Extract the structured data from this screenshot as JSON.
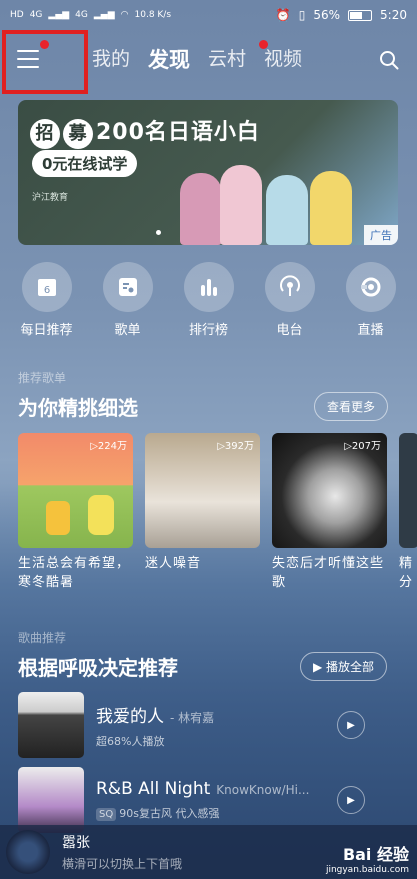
{
  "status": {
    "signal_left": "HD",
    "net1": "4G",
    "net2": "4G",
    "speed": "10.8 K/s",
    "battery": "56%",
    "time": "5:20"
  },
  "nav": {
    "tabs": [
      "我的",
      "发现",
      "云村",
      "视频"
    ],
    "active_index": 1
  },
  "banner": {
    "badge1": "招",
    "badge2": "募",
    "headline": "200名日语小白",
    "sub": "0元在线试学",
    "brand": "沪江教育",
    "ad_label": "广告"
  },
  "quick": [
    {
      "label": "每日推荐",
      "icon": "calendar-icon",
      "day": "6"
    },
    {
      "label": "歌单",
      "icon": "playlist-icon"
    },
    {
      "label": "排行榜",
      "icon": "chart-icon"
    },
    {
      "label": "电台",
      "icon": "radio-icon"
    },
    {
      "label": "直播",
      "icon": "live-icon"
    }
  ],
  "playlists": {
    "small_title": "推荐歌单",
    "title": "为你精挑细选",
    "more": "查看更多",
    "items": [
      {
        "count": "▷224万",
        "title": "生活总会有希望，寒冬酷暑"
      },
      {
        "count": "▷392万",
        "title": "迷人噪音"
      },
      {
        "count": "▷207万",
        "title": "失恋后才听懂这些歌"
      },
      {
        "count": "",
        "title": "精分"
      }
    ]
  },
  "songs": {
    "small_title": "歌曲推荐",
    "title": "根据呼吸决定推荐",
    "play_all": "▶ 播放全部",
    "items": [
      {
        "name": "我爱的人",
        "artist": "- 林宥嘉",
        "tag": "",
        "desc": "超68%人播放"
      },
      {
        "name": "R&B All Night",
        "artist": "KnowKnow/Hi...",
        "tag": "SQ",
        "desc": "90s复古风 代入感强"
      }
    ]
  },
  "player": {
    "name": "嚣张",
    "hint": "横滑可以切换上下首哦"
  },
  "watermark": {
    "line1": "Bai 经验",
    "line2": "jingyan.baidu.com"
  },
  "colors": {
    "accent_red": "#e8232c",
    "highlight_box": "#e02020"
  }
}
